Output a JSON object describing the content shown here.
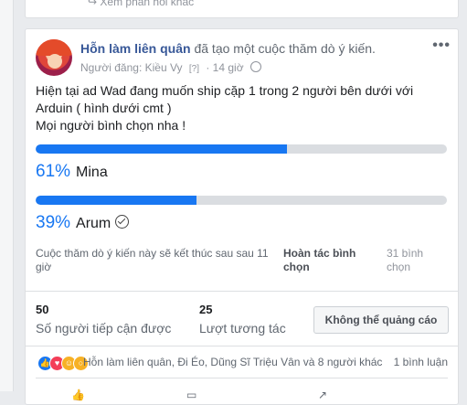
{
  "previous_post": {
    "link_text": "Xem phản hồi khác"
  },
  "post": {
    "page_name": "Hỗn làm liên quân",
    "action_text": "đã tạo một cuộc thăm dò ý kiến.",
    "posted_by": "Người đăng: Kiều Vy",
    "tag": "[?]",
    "time": "14 giờ",
    "text_lines": [
      "Hiện tại ad Wad đang muốn ship cặp 1 trong 2 người bên dưới với",
      "Arduin ( hình dưới cmt )",
      "Mọi người bình chọn nha !"
    ]
  },
  "poll": {
    "options": [
      {
        "percent_text": "61%",
        "percent": 61,
        "name": "Mina",
        "selected": false
      },
      {
        "percent_text": "39%",
        "percent": 39,
        "name": "Arum",
        "selected": true
      }
    ],
    "status_text_1": "Cuộc thăm dò ý kiến này sẽ kết thúc sau sau 11",
    "status_text_2": "giờ",
    "undo_line_1": "Hoàn tác bình",
    "undo_line_2": "chọn",
    "votes_line_1": "31 bình",
    "votes_line_2": "chọn"
  },
  "stats": {
    "reach_value": "50",
    "reach_label": "Số người tiếp cận được",
    "engagement_value": "25",
    "engagement_label": "Lượt tương tác",
    "boost_button": "Không thể quảng cáo"
  },
  "footer": {
    "reactions_text": "Hỗn làm liên quân, Đi Éo, Dũng Sĩ Triệu Vân và 8 người khác",
    "comments_text": "1 bình luận"
  },
  "colors": {
    "accent": "#1877f2",
    "link": "#385898",
    "bar_track": "#dadde1"
  }
}
